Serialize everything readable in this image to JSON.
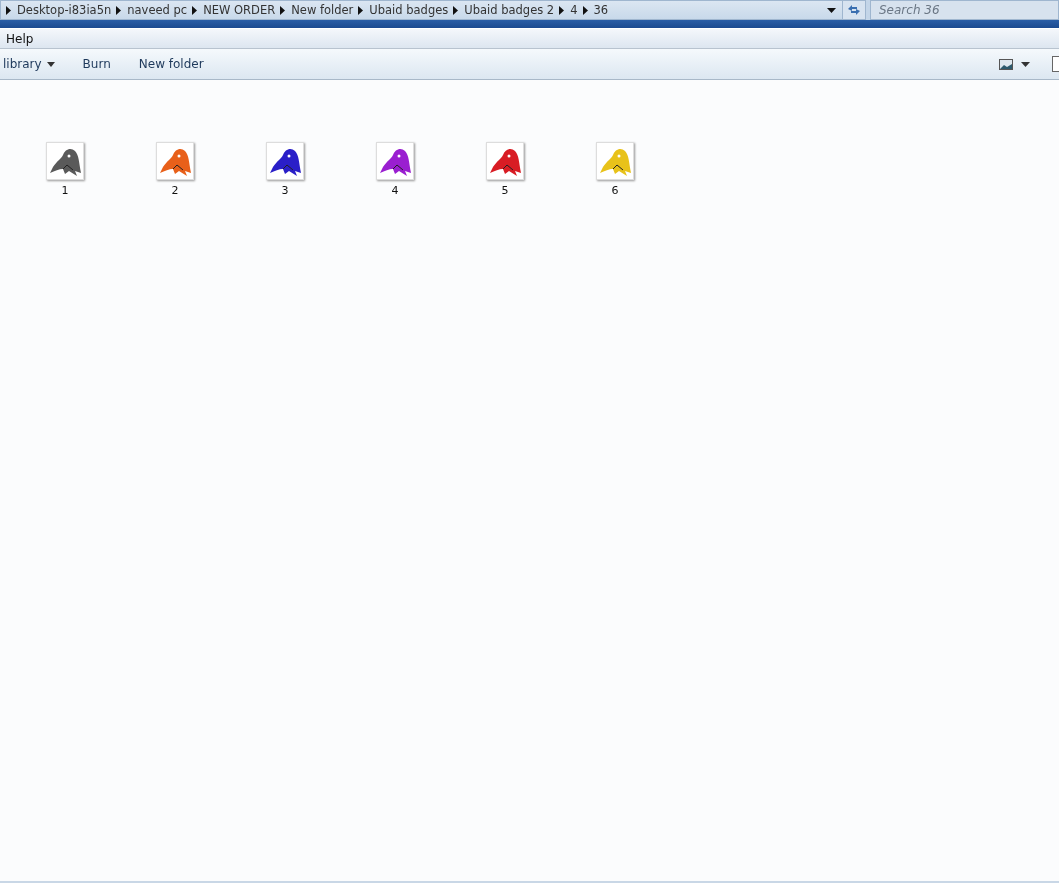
{
  "address_bar": {
    "crumbs": [
      "Desktop-i83ia5n",
      "naveed pc",
      "NEW ORDER",
      "New folder",
      "Ubaid badges",
      "Ubaid badges 2",
      "4",
      "36"
    ]
  },
  "search": {
    "placeholder": "Search 36"
  },
  "menu_bar": {
    "items": [
      "Help"
    ]
  },
  "toolbar": {
    "items": [
      {
        "label": "library",
        "kind": "dropdown"
      },
      {
        "label": "Burn",
        "kind": "button"
      },
      {
        "label": "New folder",
        "kind": "button"
      }
    ]
  },
  "files": [
    {
      "name": "1",
      "color": "#5a5a5a"
    },
    {
      "name": "2",
      "color": "#e8601a"
    },
    {
      "name": "3",
      "color": "#2a1fc8"
    },
    {
      "name": "4",
      "color": "#9a1fd0"
    },
    {
      "name": "5",
      "color": "#d81c24"
    },
    {
      "name": "6",
      "color": "#e8c21a"
    }
  ]
}
